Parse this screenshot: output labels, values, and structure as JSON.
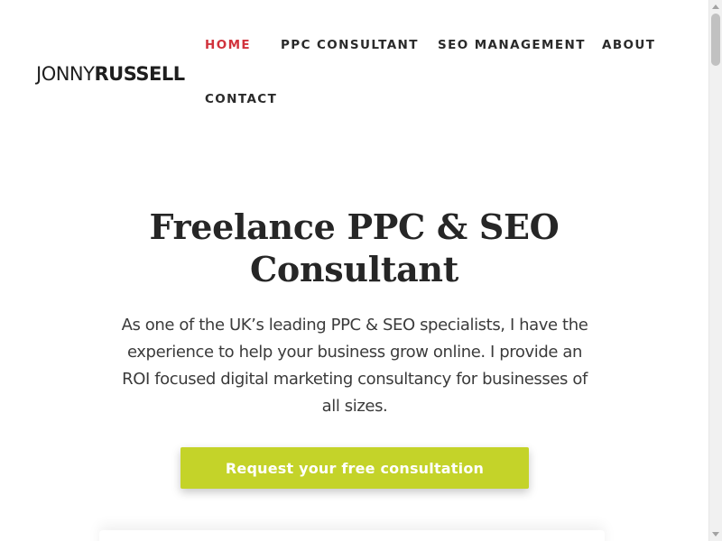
{
  "logo": {
    "part1": "JONNY",
    "part2": "RUSSELL"
  },
  "nav": {
    "home": "HOME",
    "ppc": "PPC CONSULTANT",
    "seo": "SEO MANAGEMENT",
    "about": "ABOUT",
    "contact": "CONTACT"
  },
  "hero": {
    "title_line1": "Freelance PPC & SEO",
    "title_line2": "Consultant",
    "text": "As one of the UK’s leading PPC & SEO specialists, I have the experience to help your business grow online. I provide an ROI focused digital marketing consultancy for businesses of all sizes.",
    "cta_label": "Request your free consultation"
  },
  "colors": {
    "accent_active": "#d1323c",
    "cta_background": "#c4d329",
    "text_dark": "#262626"
  }
}
